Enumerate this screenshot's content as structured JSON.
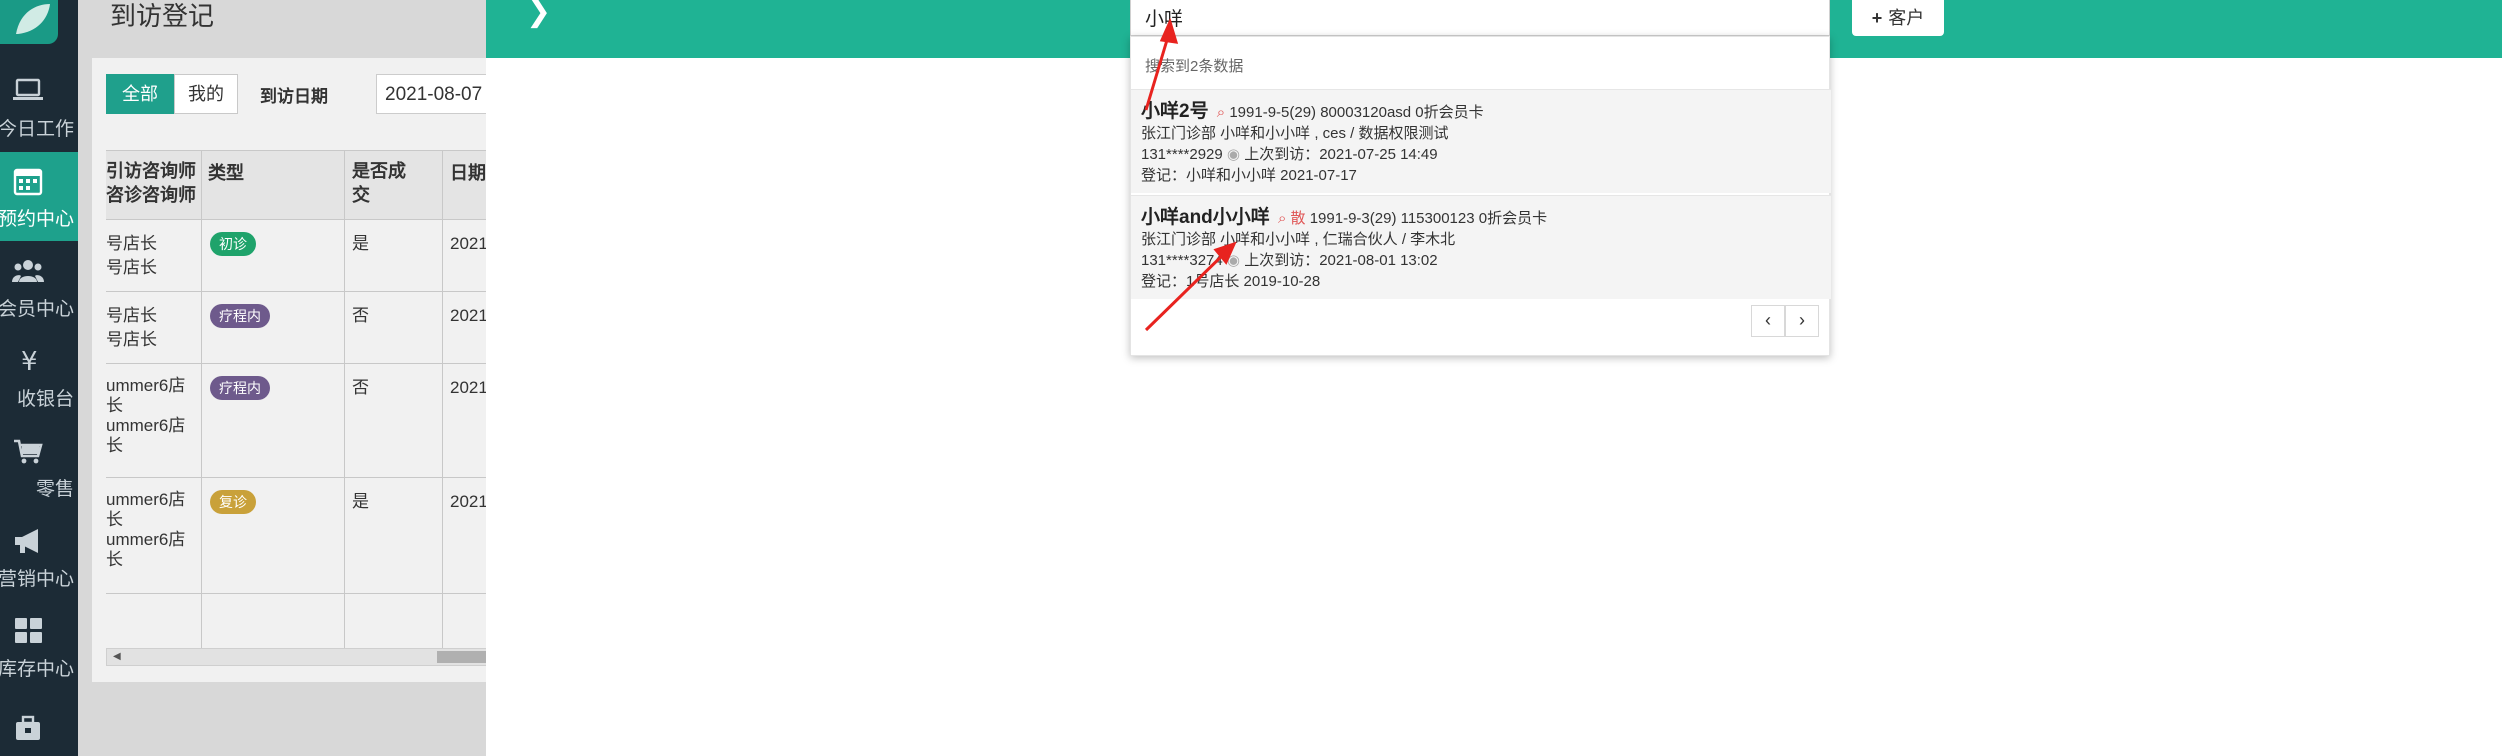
{
  "nav": {
    "items": [
      {
        "label": "今日工作",
        "icon": "laptop-icon",
        "active": false
      },
      {
        "label": "预约中心",
        "icon": "calendar-icon",
        "active": true
      },
      {
        "label": "会员中心",
        "icon": "users-icon",
        "active": false
      },
      {
        "label": "收银台",
        "icon": "yen-icon",
        "active": false
      },
      {
        "label": "零售",
        "icon": "cart-icon",
        "active": false
      },
      {
        "label": "营销中心",
        "icon": "megaphone-icon",
        "active": false
      },
      {
        "label": "库存中心",
        "icon": "grid-icon",
        "active": false
      }
    ]
  },
  "page": {
    "title": "到访登记",
    "filters": {
      "all": "全部",
      "mine": "我的",
      "date_label": "到访日期",
      "date_value": "2021-08-07"
    },
    "table": {
      "headers": [
        "引访咨询师\n咨诊咨询师",
        "类型",
        "是否成交",
        "日期"
      ],
      "rows": [
        {
          "consultant": "号店长\n号店长",
          "type": "初诊",
          "type_color": "#1fa36b",
          "deal": "是",
          "date": "2021"
        },
        {
          "consultant": "号店长\n号店长",
          "type": "疗程内",
          "type_color": "#6e5a8c",
          "deal": "否",
          "date": "2021"
        },
        {
          "consultant": "ummer6店\n长\nummer6店\n长",
          "type": "疗程内",
          "type_color": "#6e5a8c",
          "deal": "否",
          "date": "2021"
        },
        {
          "consultant": "ummer6店\n长\nummer6店\n长",
          "type": "复诊",
          "type_color": "#c9a13a",
          "deal": "是",
          "date": "2021"
        }
      ]
    }
  },
  "drawer": {
    "search_value": "小咩",
    "add_customer_label": "客户",
    "result_count_text": "搜索到2条数据",
    "results": [
      {
        "name": "小咩2号",
        "flag": "",
        "line1": "1991-9-5(29)  80003120asd 0折会员卡",
        "line2": "张江门诊部 小咩和小小咩 , ces / 数据权限测试",
        "phone": "131****2929",
        "last_visit": "上次到访：2021-07-25 14:49",
        "registered": "登记：小咩和小小咩  2021-07-17"
      },
      {
        "name": "小咩and小小咩",
        "flag": "散",
        "line1": "1991-9-3(29)  115300123 0折会员卡",
        "line2": "张江门诊部 小咩和小小咩 , 仁瑞合伙人 / 李木北",
        "phone": "131****3274",
        "last_visit": "上次到访：2021-08-01 13:02",
        "registered": "登记：1号店长  2019-10-28"
      }
    ],
    "prev_label": "‹",
    "next_label": "›"
  }
}
